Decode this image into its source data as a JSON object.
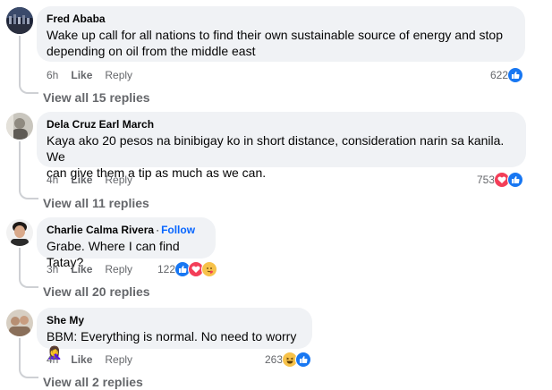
{
  "comments": [
    {
      "author": "Fred Ababa",
      "follow": "",
      "text_lines": [
        "Wake up call for all nations to find their own sustainable source of energy and stop",
        "depending on oil from the middle east"
      ],
      "time": "6h",
      "like_label": "Like",
      "reply_label": "Reply",
      "reaction_count": "622",
      "reactions": [
        "like-icon"
      ],
      "view_replies": "View all 15 replies"
    },
    {
      "author": "Dela Cruz Earl March",
      "follow": "",
      "text_lines": [
        "Kaya ako 20 pesos na binibigay ko in short distance, consideration narin sa kanila. We",
        "can give them a tip as much as we can."
      ],
      "time": "4h",
      "like_label": "Like",
      "reply_label": "Reply",
      "reaction_count": "753",
      "reactions": [
        "love-icon",
        "like-icon"
      ],
      "view_replies": "View all 11 replies"
    },
    {
      "author": "Charlie Calma Rivera",
      "follow": "Follow",
      "text_lines": [
        "Grabe. Where I can find Tatay?"
      ],
      "time": "3h",
      "like_label": "Like",
      "reply_label": "Reply",
      "reaction_count": "122",
      "reactions": [
        "like-icon",
        "love-icon",
        "care-icon"
      ],
      "view_replies": "View all 20 replies"
    },
    {
      "author": "She My",
      "follow": "",
      "text_lines": [
        "BBM: Everything is normal. No need to worry 🤦‍♀️"
      ],
      "time": "4h",
      "like_label": "Like",
      "reply_label": "Reply",
      "reaction_count": "263",
      "reactions": [
        "haha-icon",
        "like-icon"
      ],
      "view_replies": "View all 2 replies"
    }
  ],
  "colors": {
    "bubble": "#f0f2f5",
    "meta": "#65676b",
    "link": "#0866ff",
    "like": "#1877f2",
    "love": "#f33e58"
  }
}
